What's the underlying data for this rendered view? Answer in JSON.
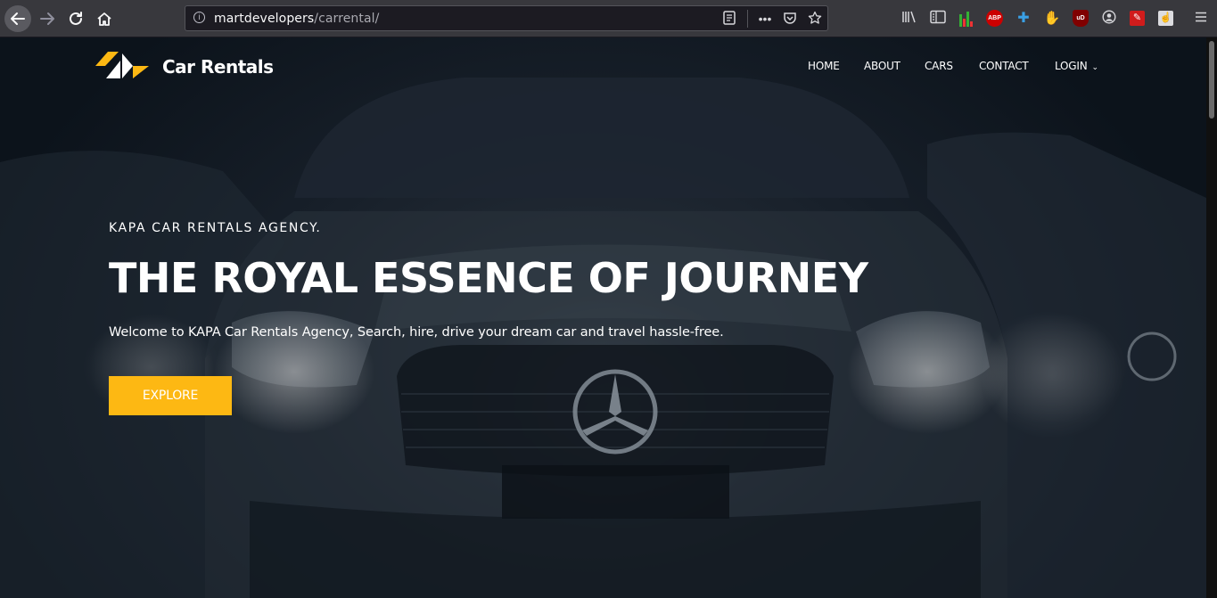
{
  "browser": {
    "url_host": "martdevelopers",
    "url_path": "/carrental/",
    "icons": {
      "back": "arrow-left-icon",
      "forward": "arrow-right-icon",
      "reload": "reload-icon",
      "home": "home-icon",
      "info": "info-icon",
      "reader": "reader-view-icon",
      "more": "more-icon",
      "pocket": "pocket-icon",
      "bookmark": "star-icon",
      "library": "library-icon",
      "sidebar": "sidebar-icon",
      "menu": "hamburger-icon"
    },
    "extensions": {
      "abp_label": "ABP",
      "ublock_label": "uD"
    }
  },
  "site": {
    "brand": "Car Rentals",
    "nav": [
      {
        "label": "HOME"
      },
      {
        "label": "ABOUT"
      },
      {
        "label": "CARS"
      },
      {
        "label": "CONTACT"
      },
      {
        "label": "LOGIN"
      }
    ]
  },
  "hero": {
    "eyebrow": "KAPA CAR RENTALS AGENCY.",
    "title": "THE ROYAL ESSENCE OF JOURNEY",
    "subtitle": "Welcome to KAPA Car Rentals Agency, Search, hire, drive your dream car and travel hassle-free.",
    "button_label": "EXPLORE"
  },
  "colors": {
    "accent": "#fdb813",
    "background": "#141c26",
    "text": "#ffffff"
  }
}
